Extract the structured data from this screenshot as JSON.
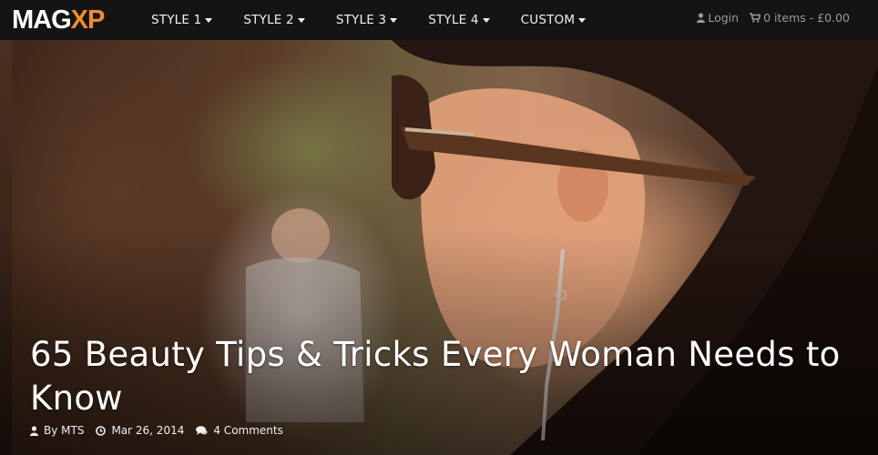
{
  "brand": {
    "logo_part1": "MAG",
    "logo_part2": "XP",
    "accent": "#f28b2c"
  },
  "nav": {
    "items": [
      {
        "label": "STYLE 1"
      },
      {
        "label": "STYLE 2"
      },
      {
        "label": "STYLE 3"
      },
      {
        "label": "STYLE 4"
      },
      {
        "label": "CUSTOM"
      }
    ]
  },
  "account": {
    "login_label": "Login",
    "login_icon": "user-icon",
    "cart_label": "0 items - £0.00",
    "cart_icon": "cart-icon"
  },
  "hero": {
    "title": "65 Beauty Tips & Tricks Every Woman Needs to Know",
    "author": "By MTS",
    "author_icon": "user-icon",
    "date": "Mar 26, 2014",
    "date_icon": "clock-icon",
    "comments": "4 Comments",
    "comments_icon": "comments-icon"
  }
}
